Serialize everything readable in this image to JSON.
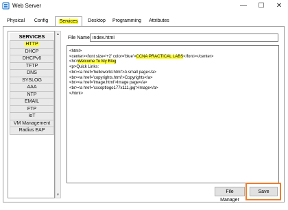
{
  "window": {
    "title": "Web Server",
    "controls": {
      "minimize": "—",
      "maximize": "☐",
      "close": "✕"
    }
  },
  "tabs": [
    {
      "label": "Physical",
      "active": false
    },
    {
      "label": "Config",
      "active": false
    },
    {
      "label": "Services",
      "active": true,
      "highlighted": true
    },
    {
      "label": "Desktop",
      "active": false
    },
    {
      "label": "Programming",
      "active": false
    },
    {
      "label": "Attributes",
      "active": false
    }
  ],
  "sidebar": {
    "header": "SERVICES",
    "items": [
      {
        "label": "HTTP",
        "selected": true
      },
      {
        "label": "DHCP"
      },
      {
        "label": "DHCPv6"
      },
      {
        "label": "TFTP"
      },
      {
        "label": "DNS"
      },
      {
        "label": "SYSLOG"
      },
      {
        "label": "AAA"
      },
      {
        "label": "NTP"
      },
      {
        "label": "EMAIL"
      },
      {
        "label": "FTP"
      },
      {
        "label": "IoT"
      },
      {
        "label": "VM Management"
      },
      {
        "label": "Radius EAP"
      }
    ]
  },
  "editor": {
    "file_name_label": "File Name:",
    "file_name_value": "index.html",
    "lines": [
      [
        {
          "t": "<html>"
        }
      ],
      [
        {
          "t": "<center><font size='+2' color='blue'>"
        },
        {
          "t": "CCNA PRACTICAL LABS",
          "hl": true
        },
        {
          "t": "</font></center>"
        }
      ],
      [
        {
          "t": "<hr>"
        },
        {
          "t": "Welcome To My Blog",
          "hl": true
        }
      ],
      [
        {
          "t": "<p>Quick Links:"
        }
      ],
      [
        {
          "t": "<br><a href='helloworld.html'>A small page</a>"
        }
      ],
      [
        {
          "t": "<br><a href='copyrights.html'>Copyrights</a>"
        }
      ],
      [
        {
          "t": "<br><a href='image.html'>Image page</a>"
        }
      ],
      [
        {
          "t": "<br><a href='cscoptlogo177x111.jpg'>Image</a>"
        }
      ],
      [
        {
          "t": "</html>"
        }
      ]
    ]
  },
  "buttons": {
    "file_manager": "File Manager",
    "save": "Save"
  },
  "colors": {
    "highlight": "#ffff33",
    "save_annotation": "#ee7d2b",
    "icon_blue": "#2f7fd1"
  }
}
